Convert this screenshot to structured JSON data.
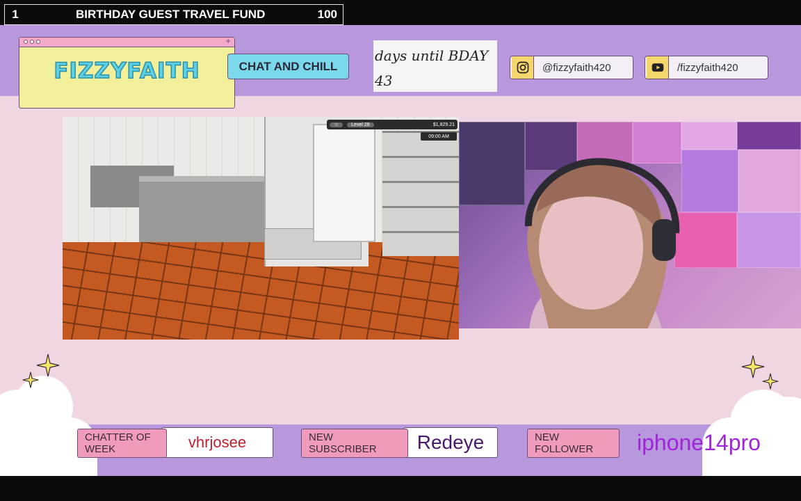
{
  "goal": {
    "count": "1",
    "title": "BIRTHDAY GUEST TRAVEL FUND",
    "target": "100"
  },
  "header": {
    "logo_text": "FIZZYFAITH",
    "tag": "CHAT AND CHILL",
    "countdown_label": "days until BDAY",
    "countdown_value": "43",
    "instagram": {
      "icon": "instagram-icon",
      "handle": "@fizzyfaith420"
    },
    "youtube": {
      "icon": "youtube-icon",
      "handle": "/fizzyfaith420"
    }
  },
  "game_hud": {
    "level": "Level 28",
    "money": "$1,829.21",
    "clock": "09:00 AM"
  },
  "footer": {
    "chatter_label": "CHATTER OF WEEK",
    "chatter_value": "vhrjosee",
    "subscriber_label": "NEW SUBSCRIBER",
    "subscriber_value": "Redeye",
    "follower_label": "NEW FOLLOWER",
    "follower_value": "iphone14pro"
  },
  "colors": {
    "purple_band": "#b898dc",
    "pink_bg": "#f0d6e2",
    "label_pink": "#f09bbc",
    "accent_cyan": "#7ad8ea",
    "logo_yellow": "#f2ef9a",
    "chatter_red": "#c02030",
    "subscriber_purple": "#4a1a6a",
    "follower_violet": "#a024d8"
  }
}
